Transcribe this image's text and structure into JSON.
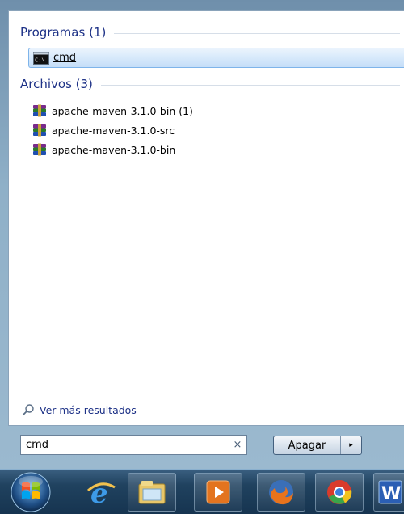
{
  "results": {
    "programs_header": "Programas (1)",
    "programs": [
      {
        "label": "cmd",
        "icon": "cmd-icon"
      }
    ],
    "files_header": "Archivos (3)",
    "files": [
      {
        "label": "apache-maven-3.1.0-bin (1)",
        "icon": "winrar-archive-icon"
      },
      {
        "label": "apache-maven-3.1.0-src",
        "icon": "winrar-archive-icon"
      },
      {
        "label": "apache-maven-3.1.0-bin",
        "icon": "winrar-archive-icon"
      }
    ],
    "more_results": "Ver más resultados"
  },
  "search": {
    "value": "cmd",
    "clear_glyph": "×"
  },
  "shutdown": {
    "label": "Apagar",
    "arrow_glyph": "▸"
  },
  "taskbar": {
    "pinned": [
      "internet-explorer-icon",
      "file-explorer-icon",
      "media-player-icon",
      "firefox-icon",
      "chrome-icon",
      "word-icon"
    ],
    "word_glyph": "W"
  }
}
